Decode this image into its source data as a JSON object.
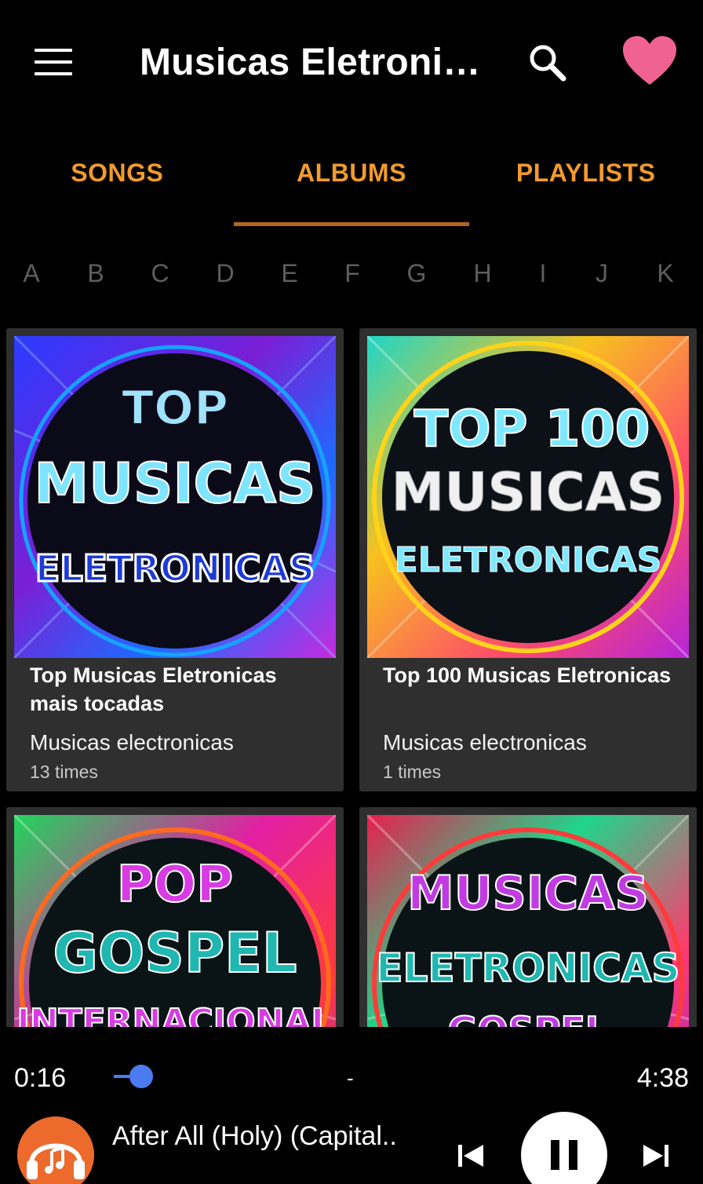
{
  "app": {
    "title": "Musicas Eletronic…",
    "menu_icon": "hamburger-menu-icon",
    "search_icon": "search-icon",
    "favorite_icon": "heart-icon",
    "accent_color": "#f29a2e",
    "favorite_color": "#f06292"
  },
  "tabs": [
    {
      "label": "SONGS",
      "selected": false
    },
    {
      "label": "ALBUMS",
      "selected": true
    },
    {
      "label": "PLAYLISTS",
      "selected": false
    }
  ],
  "alphabet": [
    "A",
    "B",
    "C",
    "D",
    "E",
    "F",
    "G",
    "H",
    "I",
    "J",
    "K"
  ],
  "albums": [
    {
      "art_text": [
        "TOP",
        "MUSICAS",
        "ELETRONICAS"
      ],
      "title": "Top Musicas Eletronicas mais tocadas",
      "artist": "Musicas electronicas",
      "count": "13 times"
    },
    {
      "art_text": [
        "TOP 100",
        "MUSICAS",
        "ELETRONICAS"
      ],
      "title": "Top 100 Musicas Eletronicas",
      "artist": "Musicas electronicas",
      "count": "1 times"
    },
    {
      "art_text": [
        "POP",
        "GOSPEL",
        "INTERNACIONAL"
      ]
    },
    {
      "art_text": [
        "MUSICAS",
        "ELETRONICAS",
        "GOSPEL"
      ]
    }
  ],
  "player": {
    "current_time": "0:16",
    "total_time": "4:38",
    "separator": "-",
    "track_title": "After All (Holy) (Capital..",
    "seek_color": "#4a7cf0",
    "prev_icon": "skip-previous-icon",
    "play_icon": "pause-icon",
    "next_icon": "skip-next-icon",
    "now_playing_art_icon": "headphones-music-icon"
  }
}
